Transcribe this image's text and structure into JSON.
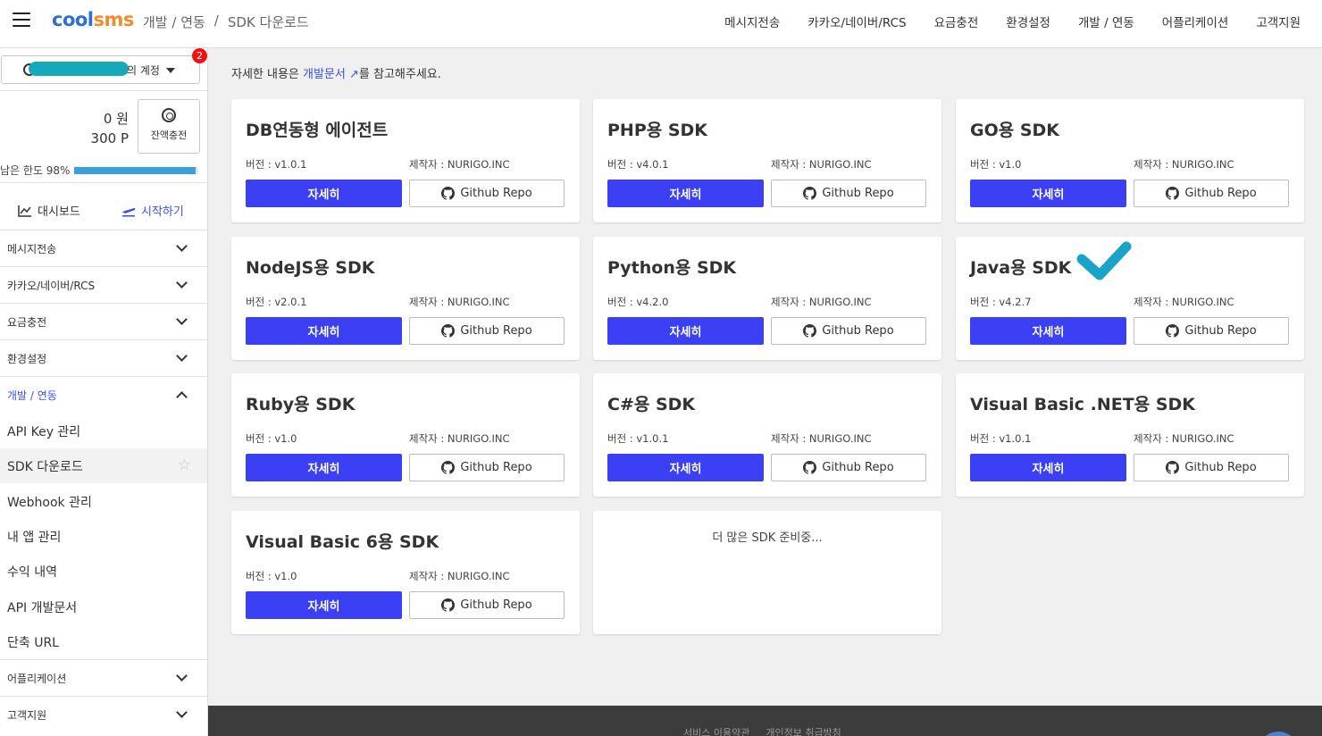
{
  "header": {
    "logo_main": "cool",
    "logo_accent": "sms",
    "breadcrumb": [
      "개발 / 연동",
      "/",
      "SDK 다운로드"
    ],
    "nav": [
      "메시지전송",
      "카카오/네이버/RCS",
      "요금충전",
      "환경설정",
      "개발 / 연동",
      "어플리케이션",
      "고객지원"
    ]
  },
  "sidebar": {
    "account_label": "의 계정",
    "badge": "2",
    "balance_won": "0 원",
    "balance_point": "300 P",
    "charge_label": "잔액충전",
    "limit_label": "남은 한도 98%",
    "limit_fraction": 0.98,
    "dashboard": "대시보드",
    "start": "시작하기",
    "sections_top": [
      "메시지전송",
      "카카오/네이버/RCS",
      "요금충전",
      "환경설정"
    ],
    "active_section": "개발 / 연동",
    "sub_items": [
      "API Key 관리",
      "SDK 다운로드",
      "Webhook 관리",
      "내 앱 관리",
      "수익 내역",
      "API 개발문서",
      "단축 URL"
    ],
    "sections_bottom": [
      "어플리케이션",
      "고객지원"
    ]
  },
  "main": {
    "info_prefix": "자세한 내용은 ",
    "info_link": "개발문서 ↗",
    "info_suffix": "를 참고해주세요.",
    "detail_label": "자세히",
    "github_label": "Github Repo",
    "more_text": "더 많은 SDK 준비중...",
    "cards": [
      {
        "title": "DB연동형 에이전트",
        "version": "버전 : v1.0.1",
        "maker": "제작자 : NURIGO.INC"
      },
      {
        "title": "PHP용 SDK",
        "version": "버전 : v4.0.1",
        "maker": "제작자 : NURIGO.INC"
      },
      {
        "title": "GO용 SDK",
        "version": "버전 : v1.0",
        "maker": "제작자 : NURIGO.INC"
      },
      {
        "title": "NodeJS용 SDK",
        "version": "버전 : v2.0.1",
        "maker": "제작자 : NURIGO.INC"
      },
      {
        "title": "Python용 SDK",
        "version": "버전 : v4.2.0",
        "maker": "제작자 : NURIGO.INC"
      },
      {
        "title": "Java용 SDK",
        "version": "버전 : v4.2.7",
        "maker": "제작자 : NURIGO.INC"
      },
      {
        "title": "Ruby용 SDK",
        "version": "버전 : v1.0",
        "maker": "제작자 : NURIGO.INC"
      },
      {
        "title": "C#용 SDK",
        "version": "버전 : v1.0.1",
        "maker": "제작자 : NURIGO.INC"
      },
      {
        "title": "Visual Basic .NET용 SDK",
        "version": "버전 : v1.0.1",
        "maker": "제작자 : NURIGO.INC"
      },
      {
        "title": "Visual Basic 6용 SDK",
        "version": "버전 : v1.0",
        "maker": "제작자 : NURIGO.INC"
      }
    ]
  },
  "footer": {
    "links": [
      "서비스 이용약관",
      "개인정보 취급방침"
    ]
  },
  "colors": {
    "primary": "#3b40f5",
    "link": "#3b4ef5",
    "checkmark": "#1aa3c8",
    "footer": "#3c3c3c"
  }
}
